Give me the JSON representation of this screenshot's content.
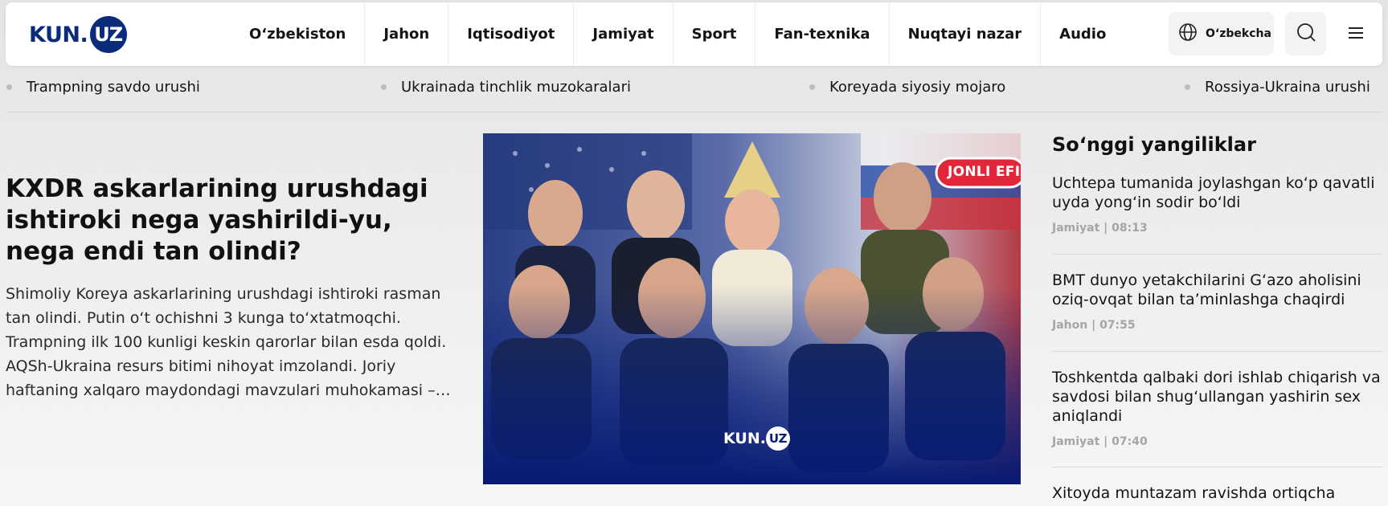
{
  "logo": {
    "left": "KUN",
    "dot": ".",
    "circle": "UZ"
  },
  "nav": [
    "O‘zbekiston",
    "Jahon",
    "Iqtisodiyot",
    "Jamiyat",
    "Sport",
    "Fan-texnika",
    "Nuqtayi nazar",
    "Audio"
  ],
  "language": {
    "label": "O‘zbekcha",
    "icon": "globe-icon"
  },
  "icons": {
    "search": "search-icon",
    "menu": "hamburger-menu-icon"
  },
  "topics": [
    "Trampning savdo urushi",
    "Ukrainada tinchlik muzokaralari",
    "Koreyada siyosiy mojaro",
    "Rossiya-Ukraina urushi"
  ],
  "lead": {
    "title": "KXDR askarlarining urushdagi ishtiroki nega yashirildi-yu, nega endi tan olindi?",
    "description": "Shimoliy Koreya askarlarining urushdagi ishtiroki rasman tan olindi. Putin o‘t ochishni 3 kunga to‘xtatmoqchi. Trampning ilk 100 kunligi keskin qarorlar bilan esda qoldi. AQSh-Ukraina resurs bitimi nihoyat imzolandi. Joriy haftaning xalqaro maydondagi mavzulari muhokamasi –…",
    "image": {
      "badge": "JONLI EFIR",
      "watermark_left": "KUN.",
      "watermark_circle": "UZ"
    }
  },
  "latest": {
    "title": "So‘nggi yangiliklar",
    "items": [
      {
        "title": "Uchtepa tumanida joylashgan ko‘p qavatli uyda yong‘in sodir bo‘ldi",
        "meta": "Jamiyat | 08:13"
      },
      {
        "title": "BMT dunyo yetakchilarini G‘azo aholisini oziq-ovqat bilan ta’minlashga chaqirdi",
        "meta": "Jahon | 07:55"
      },
      {
        "title": "Toshkentda qalbaki dori ishlab chiqarish va savdosi bilan shug‘ullangan yashirin sex aniqlandi",
        "meta": "Jamiyat | 07:40"
      },
      {
        "title": "Xitoyda muntazam ravishda ortiqcha ishlab",
        "meta": ""
      }
    ]
  },
  "colors": {
    "brand": "#0a2a7a",
    "badge": "#e3263a"
  }
}
